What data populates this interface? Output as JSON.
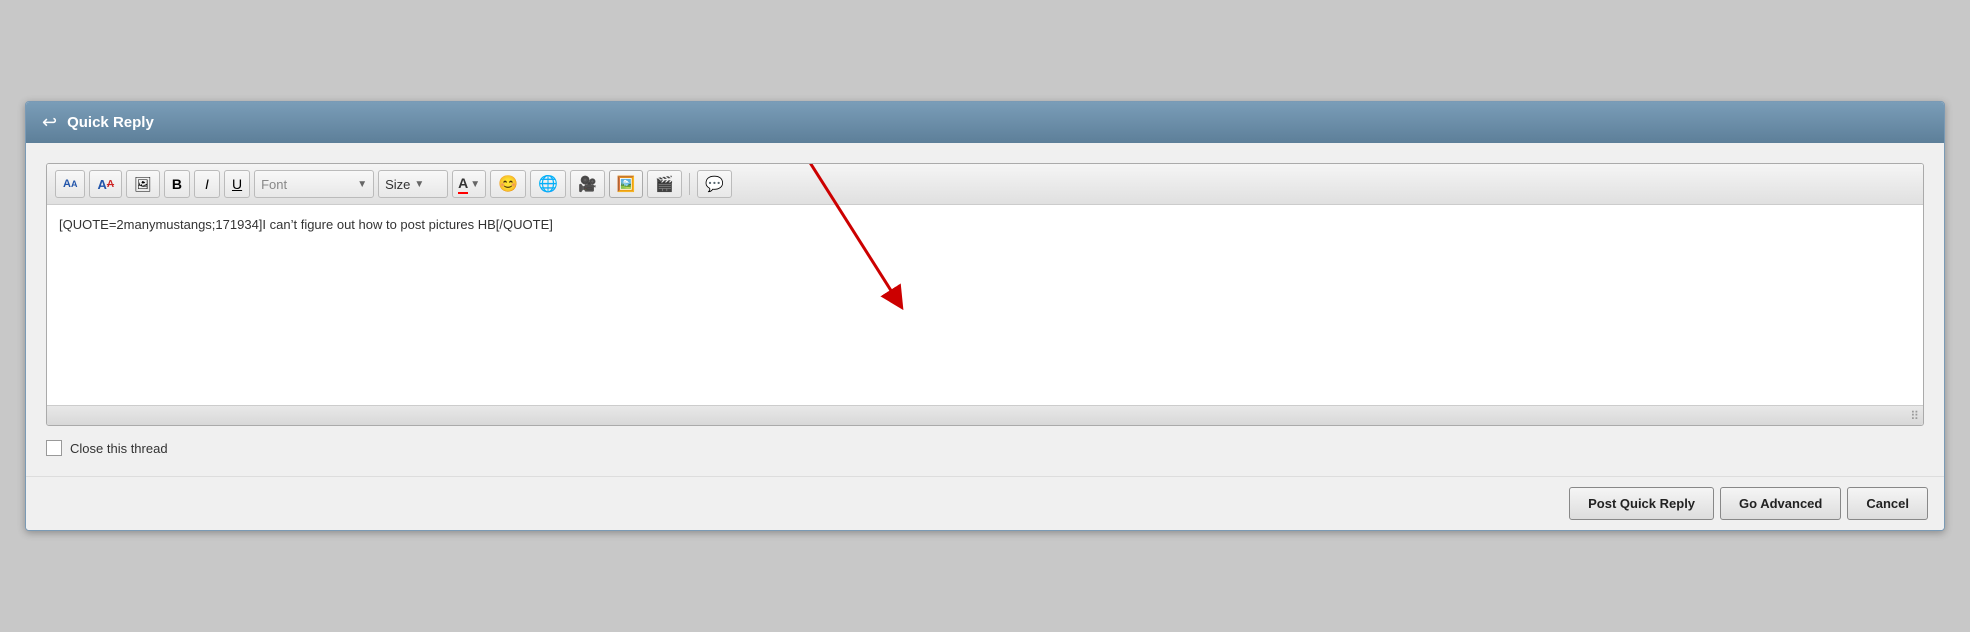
{
  "header": {
    "title": "Quick Reply",
    "back_icon": "↩"
  },
  "toolbar": {
    "font_label": "Font",
    "size_label": "Size",
    "bold_label": "B",
    "italic_label": "I",
    "underline_label": "U",
    "dropdown_arrow": "▼",
    "color_label": "A"
  },
  "editor": {
    "content": "[QUOTE=2manymustangs;171934]I can’t figure out how to post pictures HB[/QUOTE]"
  },
  "footer_options": {
    "close_thread_label": "Close this thread"
  },
  "buttons": {
    "post_quick_reply": "Post Quick Reply",
    "go_advanced": "Go Advanced",
    "cancel": "Cancel"
  }
}
